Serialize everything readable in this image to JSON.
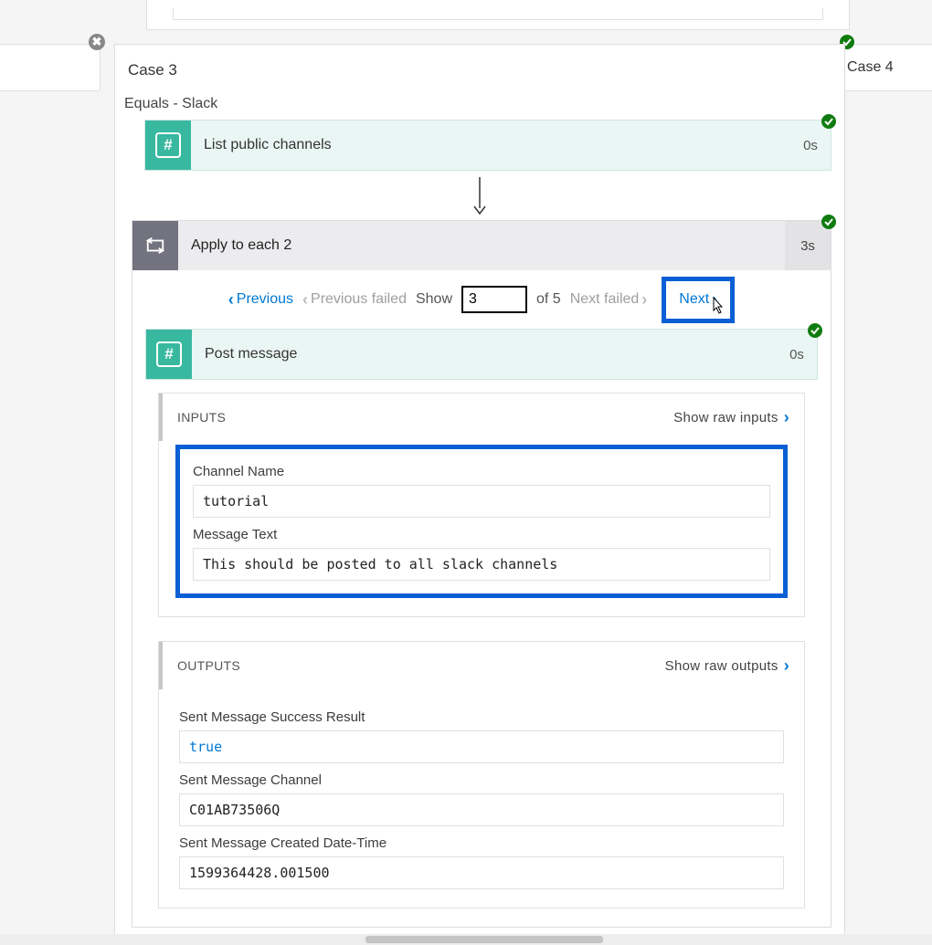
{
  "sideTabLeft": "",
  "sideTabRight": "Case 4",
  "caseTitle": "Case 3",
  "caseSubtitle": "Equals - Slack",
  "action1": {
    "label": "List public channels",
    "time": "0s"
  },
  "loop": {
    "label": "Apply to each 2",
    "time": "3s"
  },
  "pager": {
    "prev": "Previous",
    "prevFailed": "Previous failed",
    "showLabel": "Show",
    "showValue": "3",
    "ofLabel": "of 5",
    "nextFailed": "Next failed",
    "next": "Next"
  },
  "postMessage": {
    "label": "Post message",
    "time": "0s"
  },
  "inputs": {
    "header": "INPUTS",
    "rawLink": "Show raw inputs",
    "channelNameLabel": "Channel Name",
    "channelNameValue": "tutorial",
    "messageTextLabel": "Message Text",
    "messageTextValue": "This should be posted to all slack channels"
  },
  "outputs": {
    "header": "OUTPUTS",
    "rawLink": "Show raw outputs",
    "successLabel": "Sent Message Success Result",
    "successValue": "true",
    "channelLabel": "Sent Message Channel",
    "channelValue": "C01AB73506Q",
    "createdLabel": "Sent Message Created Date-Time",
    "createdValue": "1599364428.001500"
  }
}
